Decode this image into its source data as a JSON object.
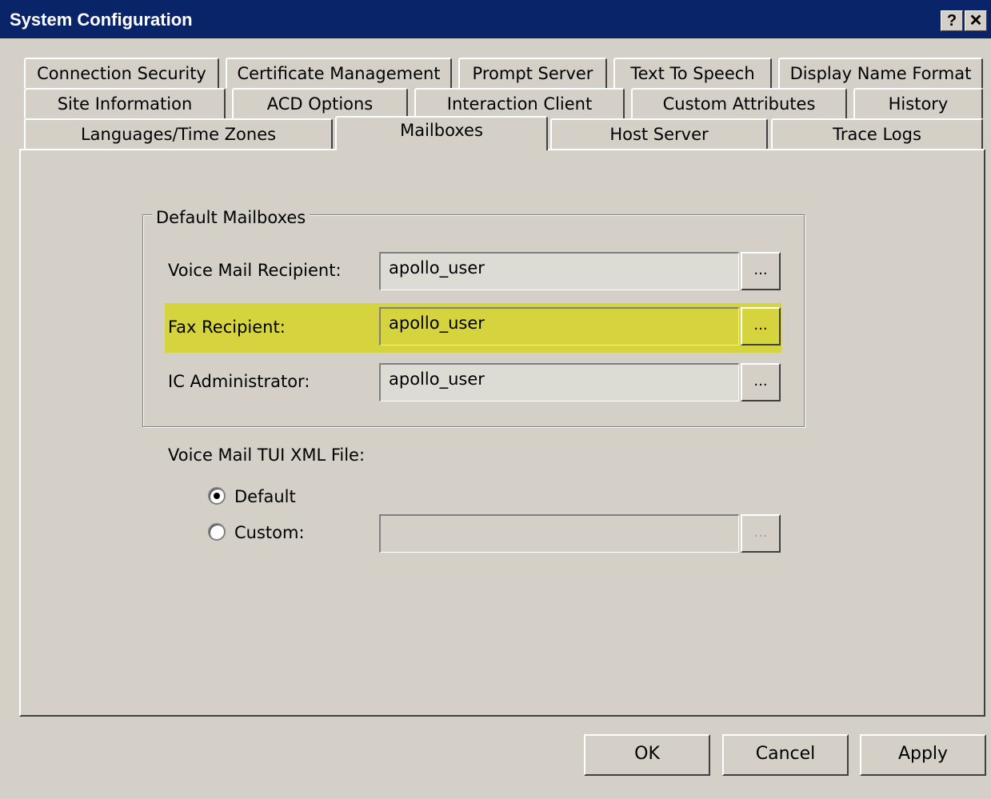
{
  "window": {
    "title": "System Configuration",
    "help_glyph": "?",
    "close_glyph": "✕"
  },
  "tabs": {
    "row1": [
      "Connection Security",
      "Certificate Management",
      "Prompt Server",
      "Text To Speech",
      "Display Name Format"
    ],
    "row2": [
      "Site Information",
      "ACD Options",
      "Interaction Client",
      "Custom Attributes",
      "History"
    ],
    "row3": [
      "Languages/Time Zones",
      "Mailboxes",
      "Host Server",
      "Trace Logs"
    ],
    "active": "Mailboxes"
  },
  "default_mailboxes": {
    "group_title": "Default Mailboxes",
    "voice_mail_label": "Voice Mail Recipient:",
    "voice_mail_value": "apollo_user",
    "fax_label": "Fax Recipient:",
    "fax_value": "apollo_user",
    "ic_admin_label": "IC Administrator:",
    "ic_admin_value": "apollo_user",
    "browse_label": "..."
  },
  "tui": {
    "label": "Voice Mail TUI XML File:",
    "default_label": "Default",
    "custom_label": "Custom:",
    "selected": "Default",
    "custom_value": "",
    "browse_label": "..."
  },
  "buttons": {
    "ok": "OK",
    "cancel": "Cancel",
    "apply": "Apply"
  },
  "colors": {
    "titlebar": "#0a246a",
    "highlight": "#d6d43e",
    "face": "#d4d0c8"
  }
}
